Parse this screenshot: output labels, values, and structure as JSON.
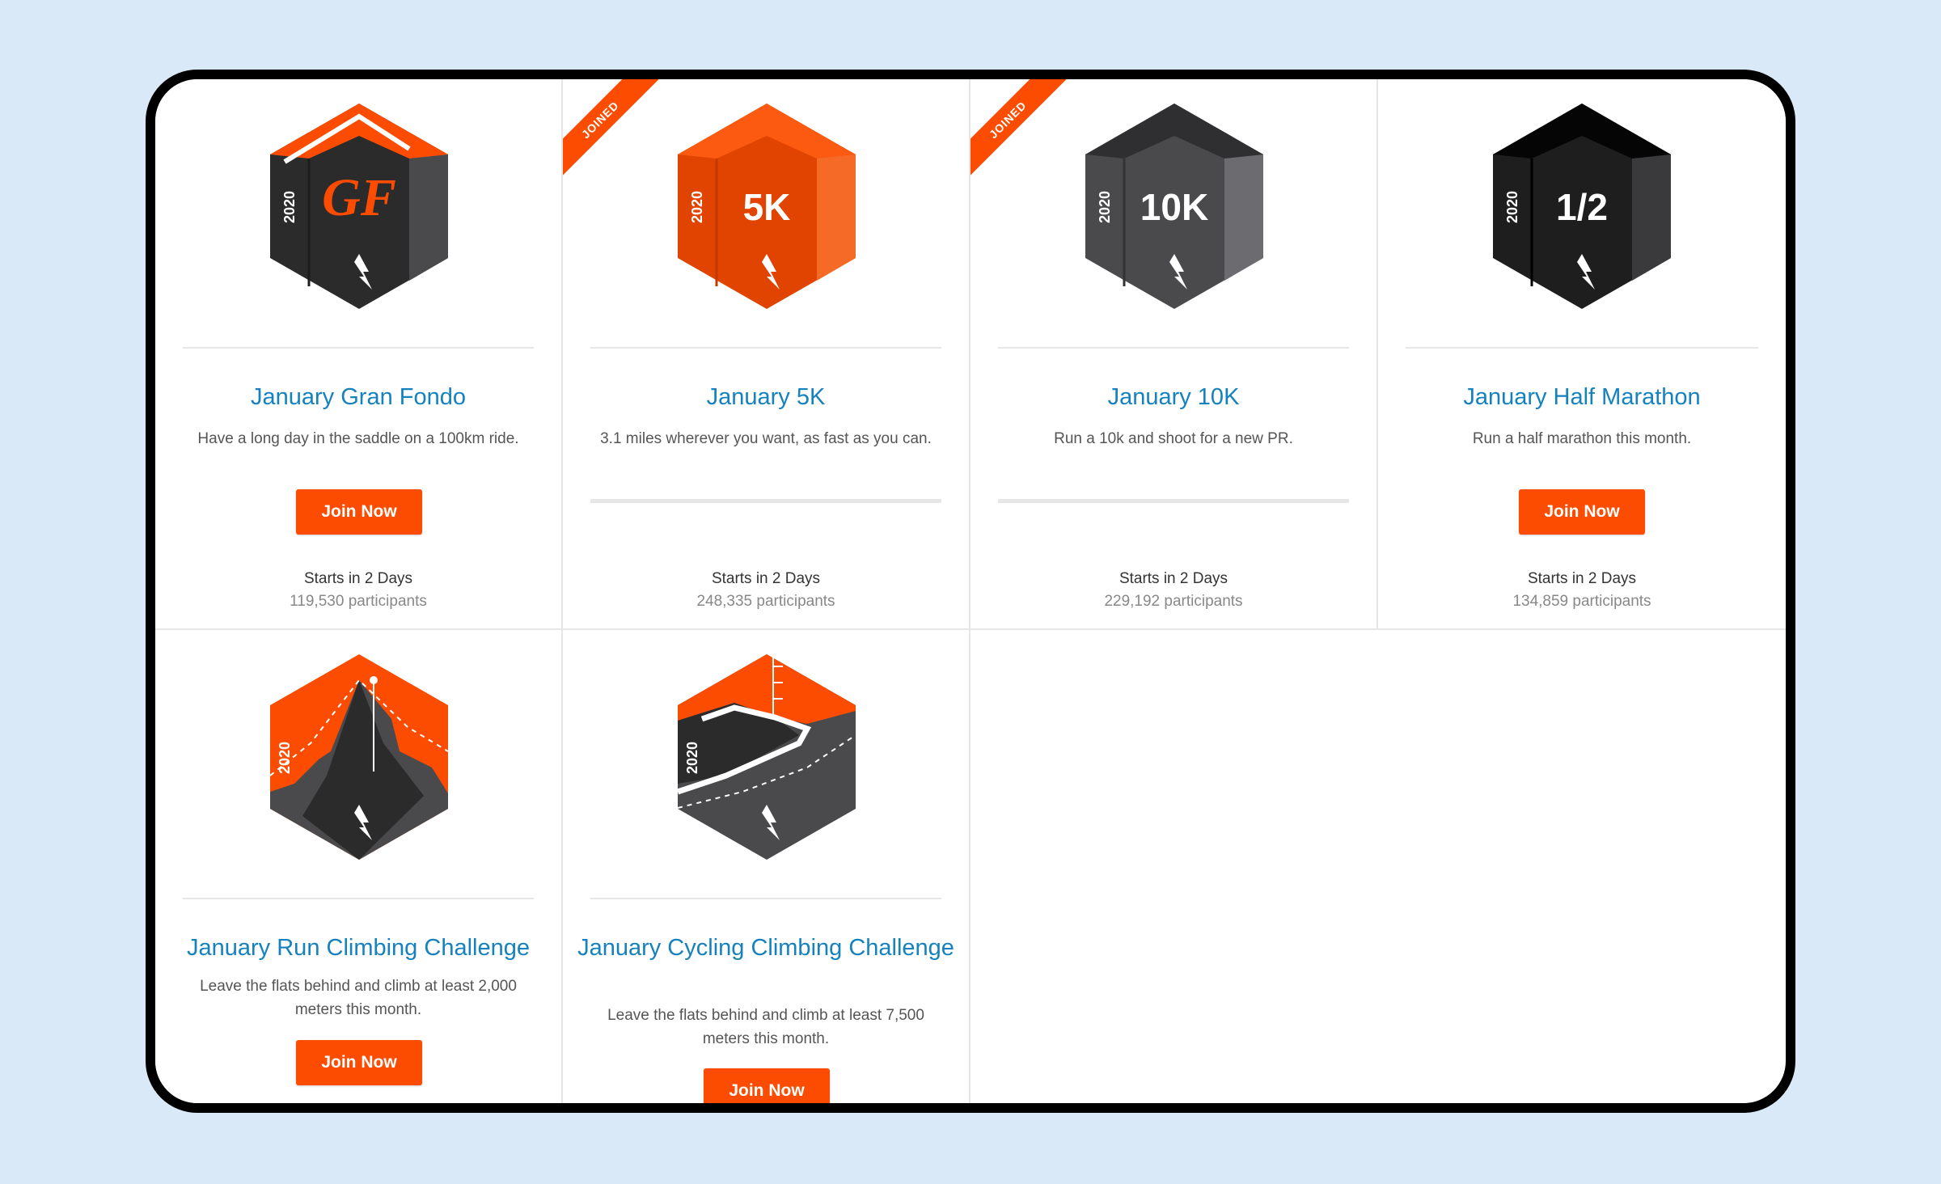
{
  "colors": {
    "accent": "#fc4c02",
    "link": "#1582bd",
    "badge_dark": "#2b2b2b",
    "badge_grey": "#4a4a4d"
  },
  "challenges": [
    {
      "badge": {
        "year": "2020",
        "label": "GF",
        "style": "gran-fondo",
        "icon": "strava-logo-icon"
      },
      "title": "January Gran Fondo",
      "description": "Have a long day in the saddle on a 100km ride.",
      "joined": false,
      "button_label": "Join Now",
      "starts": "Starts in 2 Days",
      "participants": "119,530 participants"
    },
    {
      "badge": {
        "year": "2020",
        "label": "5K",
        "style": "orange",
        "icon": "strava-logo-icon"
      },
      "title": "January 5K",
      "description": "3.1 miles wherever you want, as fast as you can.",
      "joined": true,
      "ribbon_label": "JOINED",
      "starts": "Starts in 2 Days",
      "participants": "248,335 participants"
    },
    {
      "badge": {
        "year": "2020",
        "label": "10K",
        "style": "grey",
        "icon": "strava-logo-icon"
      },
      "title": "January 10K",
      "description": "Run a 10k and shoot for a new PR.",
      "joined": true,
      "ribbon_label": "JOINED",
      "starts": "Starts in 2 Days",
      "participants": "229,192 participants"
    },
    {
      "badge": {
        "year": "2020",
        "label": "1/2",
        "style": "black",
        "icon": "strava-logo-icon"
      },
      "title": "January Half Marathon",
      "description": "Run a half marathon this month.",
      "joined": false,
      "button_label": "Join Now",
      "starts": "Starts in 2 Days",
      "participants": "134,859 participants"
    },
    {
      "badge": {
        "year": "2020",
        "label": "",
        "style": "mountain",
        "icon": "strava-logo-icon"
      },
      "title": "January Run Climbing Challenge",
      "description": "Leave the flats behind and climb at least 2,000 meters this month.",
      "joined": false,
      "button_label": "Join Now"
    },
    {
      "badge": {
        "year": "2020",
        "label": "",
        "style": "road",
        "icon": "strava-logo-icon"
      },
      "title": "January Cycling Climbing Challenge",
      "description": "Leave the flats behind and climb at least 7,500 meters this month.",
      "joined": false,
      "button_label": "Join Now"
    }
  ]
}
